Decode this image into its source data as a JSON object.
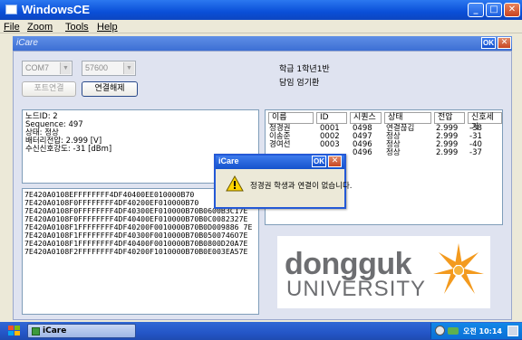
{
  "window": {
    "title": "WindowsCE",
    "minimize": "_",
    "maximize": "□",
    "close": "✕"
  },
  "menu": {
    "items": [
      {
        "label": "File"
      },
      {
        "label": "Zoom"
      },
      {
        "label": "Tools"
      },
      {
        "label": "Help"
      }
    ]
  },
  "app": {
    "title": "iCare",
    "ok": "OK",
    "close": "✕"
  },
  "connection": {
    "port": "COM7",
    "baud": "57600",
    "connect_button": "포트연결",
    "disconnect_button": "연결해제"
  },
  "class_info": {
    "grade": "학급  1학년1반",
    "teacher": "담임  엄기환"
  },
  "status": {
    "lines": [
      "노드ID: 2",
      "Sequence: 497",
      "상태: 정상",
      "배터리전압: 2.999 [V]",
      "수신신호강도: -31 [dBm]"
    ]
  },
  "log": {
    "lines": [
      "7E420A0108EFFFFFFFF4DF40400EE010000B70",
      "7E420A0108F0FFFFFFFF4DF40200EF010000B70",
      "7E420A0108F0FFFFFFFF4DF40300EF010000B70B0600B3C17E",
      "7E420A0108F0FFFFFFFF4DF40400EF010000B70B0C0082327E",
      "7E420A0108F1FFFFFFFF4DF40200F0010000B70B0D009886 7E",
      "7E420A0108F1FFFFFFFF4DF40300F0010000B70B0500746O7E",
      "7E420A0108F1FFFFFFFF4DF40400F0010000B70B0800D20A7E",
      "7E420A0108F2FFFFFFFF4DF40200F1010000B70B0E003EA57E"
    ]
  },
  "table": {
    "headers": [
      "이름",
      "ID",
      "시퀀스",
      "상태",
      "전압",
      "신호세기"
    ],
    "rows": [
      [
        "정경권",
        "0001",
        "0498",
        "연결끊김",
        "2.999",
        "-38"
      ],
      [
        "이송준",
        "0002",
        "0497",
        "정상",
        "2.999",
        "-31"
      ],
      [
        "경여선",
        "0003",
        "0496",
        "정상",
        "2.999",
        "-40"
      ],
      [
        "",
        "",
        "0496",
        "정상",
        "2.999",
        "-37"
      ]
    ]
  },
  "dialog": {
    "title": "iCare",
    "ok": "OK",
    "close": "✕",
    "message": "정경권 학생과 연결이 없습니다.",
    "icon": "warning-icon"
  },
  "logo": {
    "line1": "dongguk",
    "line2": "UNIVERSITY",
    "colors": {
      "text": "#6d6e71",
      "star": "#f39a1e"
    }
  },
  "taskbar": {
    "app_label": "iCare",
    "clock": "오전 10:14"
  }
}
